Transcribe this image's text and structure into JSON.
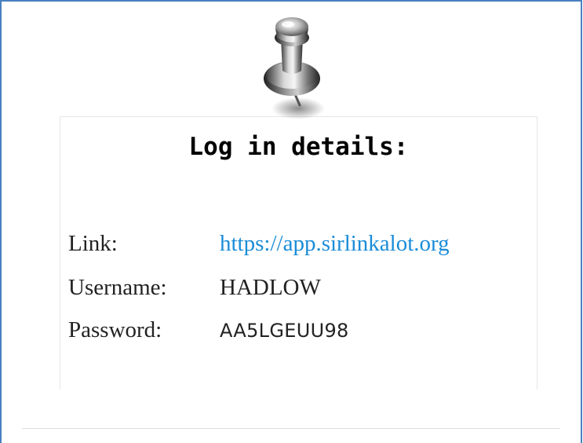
{
  "card": {
    "title": "Log in details:",
    "link_label": "Link:",
    "link_value": "https://app.sirlinkalot.org",
    "username_label": "Username:",
    "username_value": "HADLOW",
    "password_label": "Password:",
    "password_value": "AA5LGEUU98"
  },
  "icons": {
    "pin": "pushpin-icon"
  },
  "colors": {
    "frame_border": "#4a7fc1",
    "link": "#1a8cd8",
    "text": "#222222"
  }
}
